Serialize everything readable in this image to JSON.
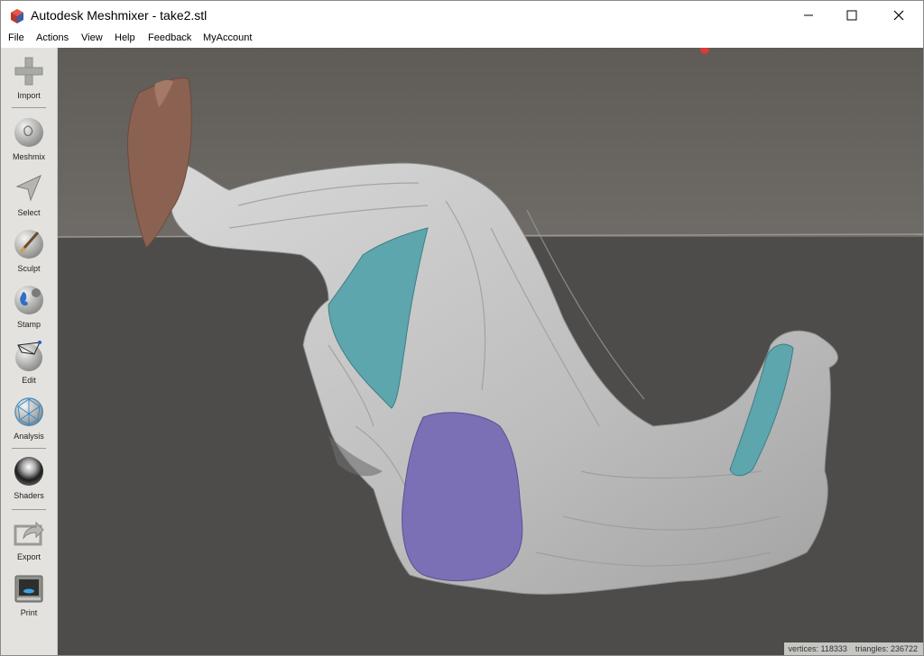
{
  "window": {
    "title": "Autodesk Meshmixer - take2.stl",
    "controls": [
      "minimize",
      "maximize",
      "close"
    ]
  },
  "menu": [
    "File",
    "Actions",
    "View",
    "Help",
    "Feedback",
    "MyAccount"
  ],
  "toolbar": {
    "tools": [
      {
        "label": "Import",
        "icon": "plus-icon"
      },
      {
        "label": "Meshmix",
        "icon": "bunny-sphere-icon"
      },
      {
        "label": "Select",
        "icon": "arrow-cursor-icon"
      },
      {
        "label": "Sculpt",
        "icon": "brush-sphere-icon"
      },
      {
        "label": "Stamp",
        "icon": "stamp-sphere-icon"
      },
      {
        "label": "Edit",
        "icon": "mesh-sphere-icon"
      },
      {
        "label": "Analysis",
        "icon": "wireframe-sphere-icon"
      },
      {
        "label": "Shaders",
        "icon": "chrome-sphere-icon"
      },
      {
        "label": "Export",
        "icon": "export-arrow-icon"
      },
      {
        "label": "Print",
        "icon": "printer-icon"
      }
    ]
  },
  "status": {
    "vertices_label": "vertices:",
    "vertices": "118333",
    "triangles_label": "triangles:",
    "triangles": "236722"
  },
  "colors": {
    "background_top": "#6a6660",
    "background_floor": "#4c4b49",
    "mesh": "#c9c9c9",
    "teal_region": "#5ea6ad",
    "purple_region": "#7b70b6",
    "brown_region": "#8b6252"
  }
}
